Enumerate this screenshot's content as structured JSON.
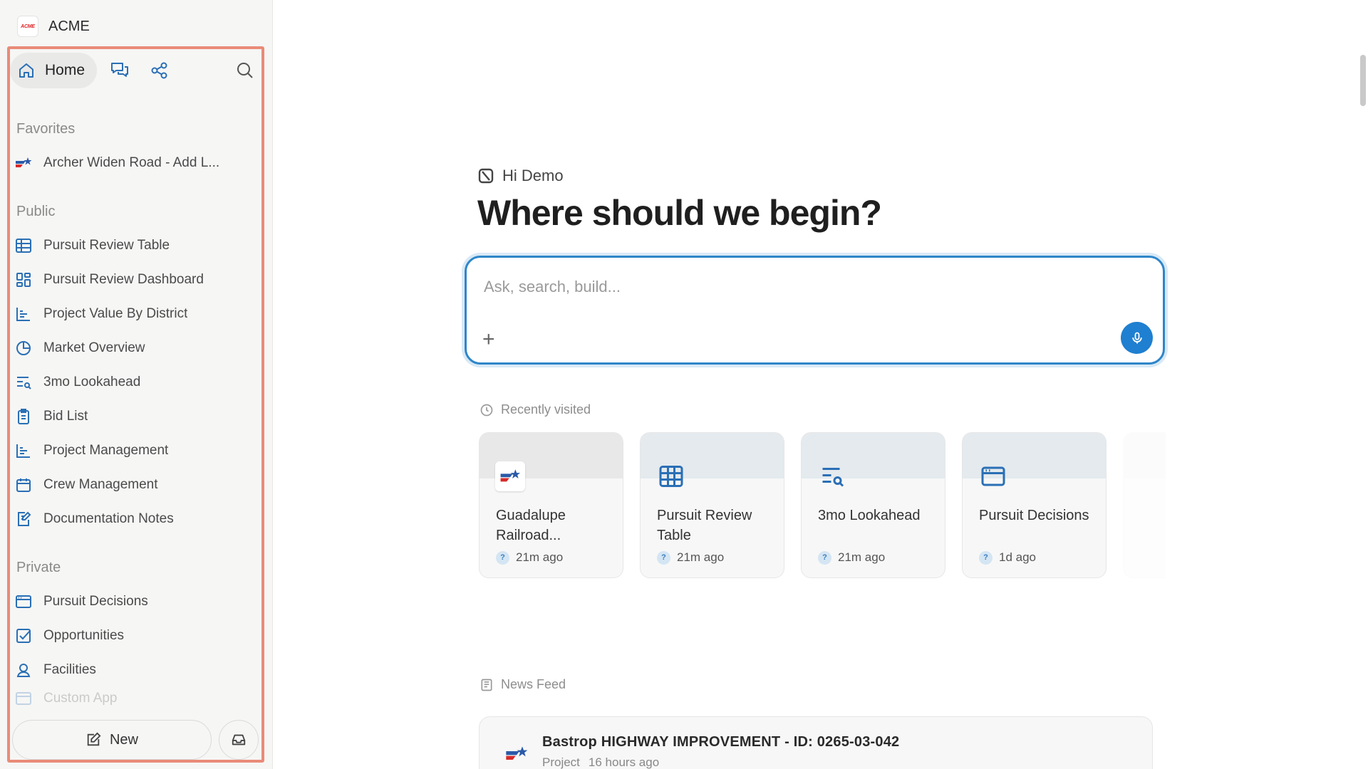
{
  "sidebar": {
    "brand": {
      "logo_text": "ACME",
      "name": "ACME"
    },
    "nav": {
      "home_label": "Home"
    },
    "sections": {
      "favorites": "Favorites",
      "public": "Public",
      "private": "Private"
    },
    "favorites": [
      {
        "label": "Archer Widen Road - Add L...",
        "icon": "txdot-logo-icon"
      }
    ],
    "public_items": [
      {
        "label": "Pursuit Review Table",
        "icon": "table-icon"
      },
      {
        "label": "Pursuit Review Dashboard",
        "icon": "dashboard-icon"
      },
      {
        "label": "Project Value By District",
        "icon": "bar-chart-icon"
      },
      {
        "label": "Market Overview",
        "icon": "pie-chart-icon"
      },
      {
        "label": "3mo Lookahead",
        "icon": "list-search-icon"
      },
      {
        "label": "Bid List",
        "icon": "clipboard-icon"
      },
      {
        "label": "Project Management",
        "icon": "bar-chart-icon"
      },
      {
        "label": "Crew Management",
        "icon": "calendar-icon"
      },
      {
        "label": "Documentation Notes",
        "icon": "note-edit-icon"
      }
    ],
    "private_items": [
      {
        "label": "Pursuit Decisions",
        "icon": "browser-window-icon"
      },
      {
        "label": "Opportunities",
        "icon": "checkbox-icon"
      },
      {
        "label": "Facilities",
        "icon": "location-user-icon"
      },
      {
        "label": "Custom App",
        "icon": "browser-window-icon"
      }
    ],
    "new_label": "New"
  },
  "main": {
    "greeting": "Hi Demo",
    "headline": "Where should we begin?",
    "prompt": {
      "placeholder": "Ask, search, build..."
    },
    "recent": {
      "heading": "Recently visited",
      "cards": [
        {
          "title": "Guadalupe Railroad...",
          "time": "21m ago",
          "icon": "txdot-logo-icon"
        },
        {
          "title": "Pursuit Review Table",
          "time": "21m ago",
          "icon": "table-icon"
        },
        {
          "title": "3mo Lookahead",
          "time": "21m ago",
          "icon": "list-search-icon"
        },
        {
          "title": "Pursuit Decisions",
          "time": "1d ago",
          "icon": "browser-window-icon"
        }
      ],
      "visitor_badge": "?"
    },
    "news": {
      "heading": "News Feed",
      "items": [
        {
          "title": "Bastrop HIGHWAY IMPROVEMENT - ID: 0265-03-042",
          "type": "Project",
          "time": "16 hours ago"
        }
      ]
    }
  },
  "colors": {
    "accent": "#1f7fd0",
    "icon_blue": "#2a6fb5",
    "highlight_frame": "#e98b78"
  }
}
